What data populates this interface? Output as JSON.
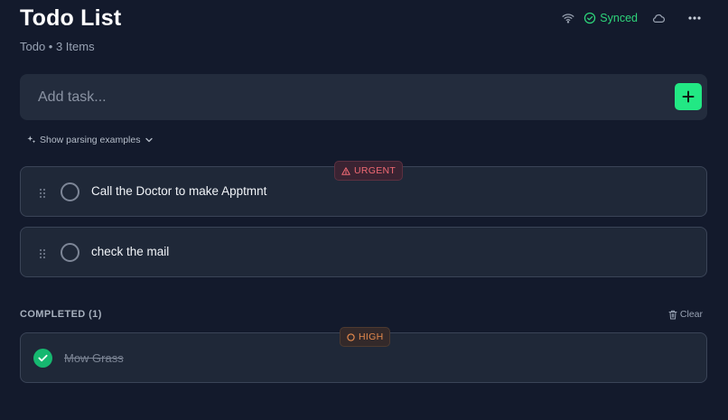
{
  "header": {
    "title": "Todo List",
    "subtitle": "Todo • 3 Items",
    "sync_label": "Synced",
    "icons": [
      "wifi-icon",
      "check-circle-icon",
      "cloud-icon",
      "more-horizontal-icon"
    ]
  },
  "add_task": {
    "placeholder": "Add task...",
    "button_icon": "plus-icon"
  },
  "parsing_toggle": {
    "label": "Show parsing examples",
    "icon": "sparkles-icon"
  },
  "tasks": [
    {
      "text": "Call the Doctor to make Apptmnt",
      "priority": "URGENT",
      "completed": false
    },
    {
      "text": "check the mail",
      "priority": null,
      "completed": false
    }
  ],
  "completed": {
    "heading": "COMPLETED (1)",
    "clear_label": "Clear",
    "items": [
      {
        "text": "Mow Grass",
        "priority": "HIGH",
        "completed": true
      }
    ]
  },
  "colors": {
    "background": "#131a2c",
    "card": "#1f2838",
    "accent_green": "#22e884",
    "synced_green": "#2ed47a",
    "urgent": "#f06a74",
    "high": "#e58a4d"
  }
}
